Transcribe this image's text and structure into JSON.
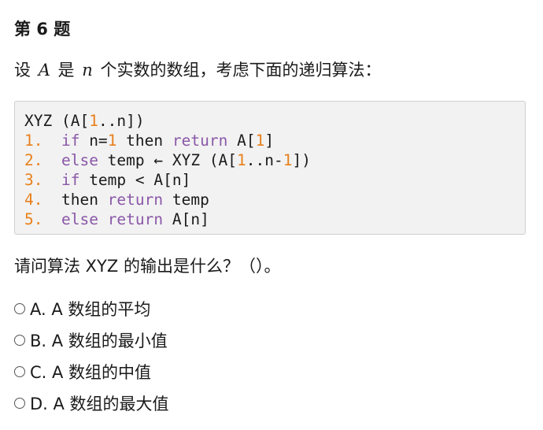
{
  "question_title": "第 6 题",
  "intro": {
    "part1": "设",
    "var_a": "A",
    "part2": "是",
    "var_n": "n",
    "part3": "个实数的数组，考虑下面的递归算法："
  },
  "code": {
    "header": {
      "t1": "XYZ (A[",
      "n1": "1",
      "t2": "..n])"
    },
    "line1": {
      "num": "1.",
      "kw1": "if",
      "t1": " n=",
      "n1": "1",
      "t2": " then ",
      "kw2": "return",
      "t3": " A[",
      "n2": "1",
      "t4": "]"
    },
    "line2": {
      "num": "2.",
      "kw1": "else",
      "t1": " temp ← XYZ (A[",
      "n1": "1",
      "t2": "..n-",
      "n2": "1",
      "t3": "])"
    },
    "line3": {
      "num": "3.",
      "kw1": "if",
      "t1": " temp < A[n]"
    },
    "line4": {
      "num": "4.",
      "t1": "then ",
      "kw1": "return",
      "t2": " temp"
    },
    "line5": {
      "num": "5.",
      "kw1": "else",
      "t1": " ",
      "kw2": "return",
      "t2": " A[n]"
    }
  },
  "question": "请问算法 XYZ 的输出是什么？（）。",
  "options": [
    {
      "label": "A. A 数组的平均"
    },
    {
      "label": "B. A 数组的最小值"
    },
    {
      "label": "C. A 数组的中值"
    },
    {
      "label": "D. A 数组的最大值"
    }
  ]
}
